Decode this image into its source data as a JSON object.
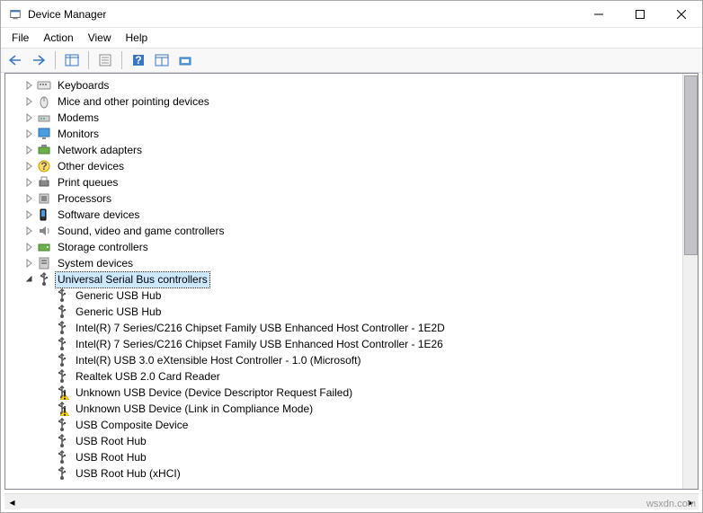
{
  "window": {
    "title": "Device Manager"
  },
  "menubar": {
    "file": "File",
    "action": "Action",
    "view": "View",
    "help": "Help"
  },
  "tree": {
    "categories": [
      {
        "label": "Keyboards",
        "icon": "keyboard",
        "expanded": false
      },
      {
        "label": "Mice and other pointing devices",
        "icon": "mouse",
        "expanded": false
      },
      {
        "label": "Modems",
        "icon": "modem",
        "expanded": false
      },
      {
        "label": "Monitors",
        "icon": "monitor",
        "expanded": false
      },
      {
        "label": "Network adapters",
        "icon": "network",
        "expanded": false
      },
      {
        "label": "Other devices",
        "icon": "other",
        "expanded": false
      },
      {
        "label": "Print queues",
        "icon": "printer",
        "expanded": false
      },
      {
        "label": "Processors",
        "icon": "cpu",
        "expanded": false
      },
      {
        "label": "Software devices",
        "icon": "software",
        "expanded": false
      },
      {
        "label": "Sound, video and game controllers",
        "icon": "sound",
        "expanded": false
      },
      {
        "label": "Storage controllers",
        "icon": "storage",
        "expanded": false
      },
      {
        "label": "System devices",
        "icon": "system",
        "expanded": false
      },
      {
        "label": "Universal Serial Bus controllers",
        "icon": "usb",
        "expanded": true,
        "selected": true
      }
    ],
    "usb_children": [
      {
        "label": "Generic USB Hub",
        "icon": "usb",
        "warn": false
      },
      {
        "label": "Generic USB Hub",
        "icon": "usb",
        "warn": false
      },
      {
        "label": "Intel(R) 7 Series/C216 Chipset Family USB Enhanced Host Controller - 1E2D",
        "icon": "usb",
        "warn": false
      },
      {
        "label": "Intel(R) 7 Series/C216 Chipset Family USB Enhanced Host Controller - 1E26",
        "icon": "usb",
        "warn": false
      },
      {
        "label": "Intel(R) USB 3.0 eXtensible Host Controller - 1.0 (Microsoft)",
        "icon": "usb",
        "warn": false
      },
      {
        "label": "Realtek USB 2.0 Card Reader",
        "icon": "usb",
        "warn": false
      },
      {
        "label": "Unknown USB Device (Device Descriptor Request Failed)",
        "icon": "usb",
        "warn": true
      },
      {
        "label": "Unknown USB Device (Link in Compliance Mode)",
        "icon": "usb",
        "warn": true
      },
      {
        "label": "USB Composite Device",
        "icon": "usb",
        "warn": false
      },
      {
        "label": "USB Root Hub",
        "icon": "usb",
        "warn": false
      },
      {
        "label": "USB Root Hub",
        "icon": "usb",
        "warn": false
      },
      {
        "label": "USB Root Hub (xHCI)",
        "icon": "usb",
        "warn": false
      }
    ]
  },
  "watermark": "wsxdn.com"
}
